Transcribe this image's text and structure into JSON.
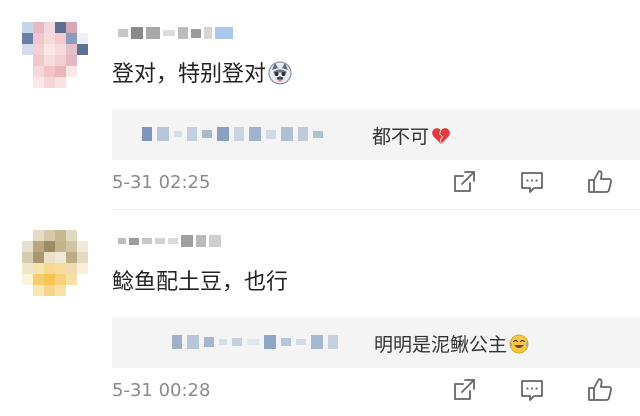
{
  "comments": [
    {
      "text": "登对，特别登对",
      "emoji": "husky-face-emoji",
      "reply": {
        "text": "都不可",
        "emoji": "broken-heart-emoji"
      },
      "time": "5-31 02:25"
    },
    {
      "text": "鲶鱼配土豆，也行",
      "emoji": "",
      "reply": {
        "text": "明明是泥鳅公主",
        "emoji": "laughing-tears-emoji"
      },
      "time": "5-31 00:28"
    }
  ],
  "actions": [
    "share-icon",
    "comment-icon",
    "like-icon"
  ],
  "colors": {
    "text": "#222222",
    "meta": "#8a8a8a",
    "reply_bg": "#f4f4f4",
    "icon": "#666666"
  }
}
